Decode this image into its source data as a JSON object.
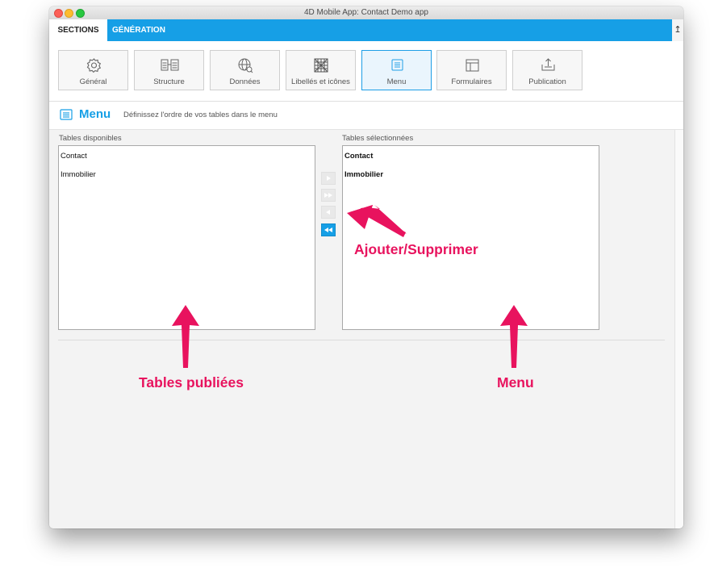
{
  "window": {
    "title": "4D Mobile App: Contact Demo app"
  },
  "tabs": {
    "sections": "SECTIONS",
    "generation": "GÉNÉRATION",
    "collapse": "↥"
  },
  "toolbar": {
    "items": [
      {
        "label": "Général",
        "icon": "gear-icon"
      },
      {
        "label": "Structure",
        "icon": "structure-icon"
      },
      {
        "label": "Données",
        "icon": "data-globe-icon"
      },
      {
        "label": "Libellés et icônes",
        "icon": "labels-grid-icon"
      },
      {
        "label": "Menu",
        "icon": "menu-list-icon",
        "active": true
      },
      {
        "label": "Formulaires",
        "icon": "forms-layout-icon"
      },
      {
        "label": "Publication",
        "icon": "publish-upload-icon"
      }
    ]
  },
  "section": {
    "title": "Menu",
    "description": "Définissez l'ordre de vos tables dans le menu"
  },
  "available": {
    "label": "Tables disponibles",
    "items": [
      "Contact",
      "Immobilier"
    ]
  },
  "selected": {
    "label": "Tables sélectionnées",
    "items": [
      "Contact",
      "Immobilier"
    ]
  },
  "move_buttons": [
    {
      "name": "add-one-button",
      "icon": "play-right-icon",
      "enabled": false
    },
    {
      "name": "add-all-button",
      "icon": "double-right-icon",
      "enabled": false
    },
    {
      "name": "remove-one-button",
      "icon": "play-left-icon",
      "enabled": false
    },
    {
      "name": "remove-all-button",
      "icon": "double-left-icon",
      "enabled": true
    }
  ],
  "annotations": {
    "add_remove": "Ajouter/Supprimer",
    "published_tables": "Tables publiées",
    "menu": "Menu"
  },
  "colors": {
    "accent": "#169fe6",
    "annotation": "#e8135e",
    "close": "#fc5f57",
    "minimize": "#fdbc2e",
    "zoom": "#28c840"
  }
}
